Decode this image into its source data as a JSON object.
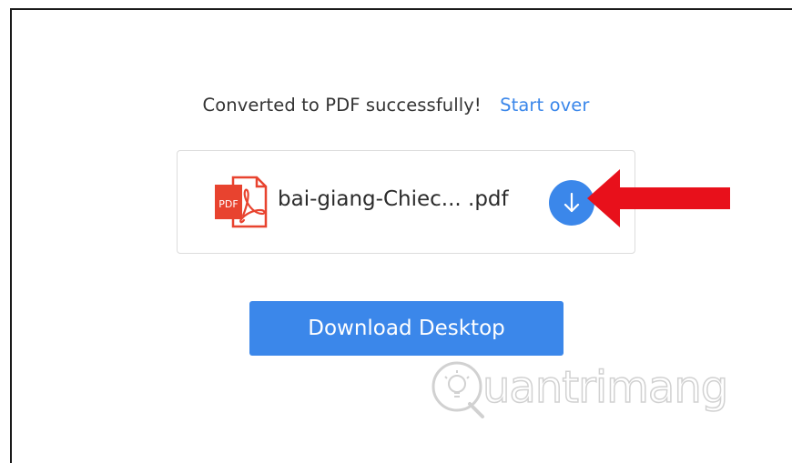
{
  "status": {
    "message": "Converted to PDF successfully!",
    "start_over_label": "Start over"
  },
  "file": {
    "icon": "pdf-file-icon",
    "icon_label": "PDF",
    "name": "bai-giang-Chiec... .pdf",
    "download_icon": "arrow-down-icon"
  },
  "annotation": {
    "icon": "red-arrow-left-icon",
    "color": "#e8101b"
  },
  "desktop_button": {
    "label": "Download Desktop"
  },
  "watermark": {
    "text": "uantrimang",
    "icon": "quantrimang-logo"
  },
  "colors": {
    "accent": "#3b87ea",
    "pdf_red": "#e8432f",
    "text": "#333333"
  }
}
